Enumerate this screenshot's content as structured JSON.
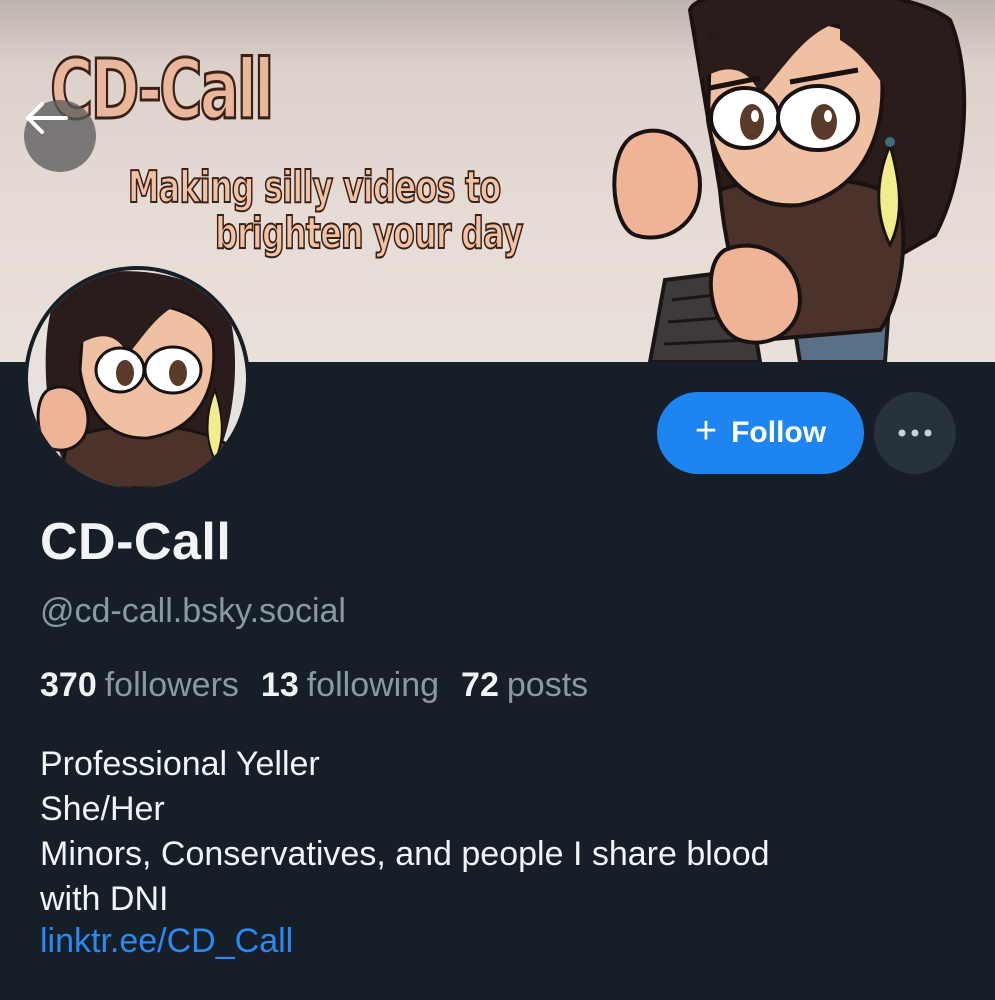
{
  "banner": {
    "title": "CD-Call",
    "tagline_line1": "Making silly videos to",
    "tagline_line2": "brighten your day"
  },
  "header": {
    "back_icon": "arrow-left-icon"
  },
  "actions": {
    "follow_label": "Follow",
    "follow_icon": "plus-icon",
    "more_icon": "ellipsis-icon",
    "accent_color": "#1d84f2"
  },
  "profile": {
    "display_name": "CD-Call",
    "handle": "@cd-call.bsky.social",
    "stats": {
      "followers_count": "370",
      "followers_label": "followers",
      "following_count": "13",
      "following_label": "following",
      "posts_count": "72",
      "posts_label": "posts"
    },
    "bio": {
      "line1": "Professional Yeller",
      "line2": "She/Her",
      "line3": "Minors, Conservatives, and people I share blood",
      "line4": "with DNI",
      "link": "linktr.ee/CD_Call"
    }
  }
}
